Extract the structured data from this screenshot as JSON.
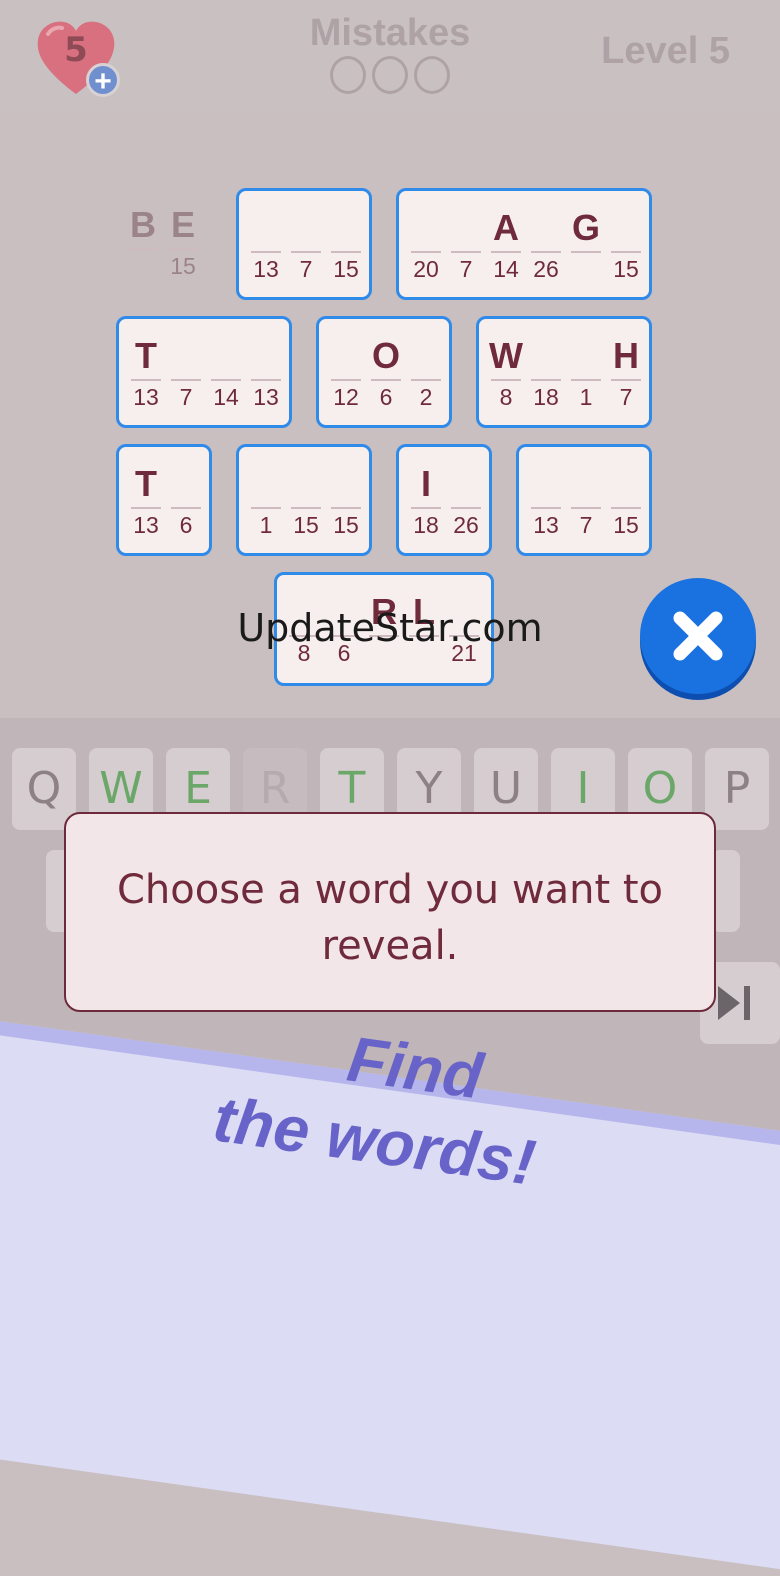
{
  "header": {
    "lives": "5",
    "mistakes_label": "Mistakes",
    "level_label": "Level 5"
  },
  "words": [
    {
      "id": "w1",
      "cells": [
        {
          "l": "B",
          "n": ""
        },
        {
          "l": "E",
          "n": "15"
        }
      ]
    },
    {
      "id": "w2",
      "cells": [
        {
          "l": "",
          "n": "13"
        },
        {
          "l": "",
          "n": "7"
        },
        {
          "l": "",
          "n": "15"
        }
      ]
    },
    {
      "id": "w3",
      "cells": [
        {
          "l": "",
          "n": "20"
        },
        {
          "l": "",
          "n": "7"
        },
        {
          "l": "A",
          "n": "14"
        },
        {
          "l": "",
          "n": "26"
        },
        {
          "l": "G",
          "n": ""
        },
        {
          "l": "",
          "n": "15"
        }
      ]
    },
    {
      "id": "w4",
      "cells": [
        {
          "l": "T",
          "n": "13"
        },
        {
          "l": "",
          "n": "7"
        },
        {
          "l": "",
          "n": "14"
        },
        {
          "l": "",
          "n": "13"
        }
      ]
    },
    {
      "id": "w5",
      "cells": [
        {
          "l": "",
          "n": "12"
        },
        {
          "l": "O",
          "n": "6"
        },
        {
          "l": "",
          "n": "2"
        }
      ]
    },
    {
      "id": "w6",
      "cells": [
        {
          "l": "W",
          "n": "8"
        },
        {
          "l": "",
          "n": "18"
        },
        {
          "l": "",
          "n": "1"
        },
        {
          "l": "H",
          "n": "7"
        }
      ]
    },
    {
      "id": "w7",
      "cells": [
        {
          "l": "T",
          "n": "13"
        },
        {
          "l": "",
          "n": "6"
        }
      ]
    },
    {
      "id": "w8",
      "cells": [
        {
          "l": "",
          "n": "1"
        },
        {
          "l": "",
          "n": "15"
        },
        {
          "l": "",
          "n": "15"
        }
      ]
    },
    {
      "id": "w9",
      "cells": [
        {
          "l": "I",
          "n": "18"
        },
        {
          "l": "",
          "n": "26"
        }
      ]
    },
    {
      "id": "w10",
      "cells": [
        {
          "l": "",
          "n": "13"
        },
        {
          "l": "",
          "n": "7"
        },
        {
          "l": "",
          "n": "15"
        }
      ]
    },
    {
      "id": "w11",
      "cells": [
        {
          "l": "",
          "n": "8"
        },
        {
          "l": "",
          "n": "6"
        },
        {
          "l": "R",
          "n": ""
        },
        {
          "l": "L",
          "n": ""
        },
        {
          "l": "",
          "n": "21"
        }
      ]
    }
  ],
  "keyboard_row1": [
    {
      "k": "Q",
      "state": "normal"
    },
    {
      "k": "W",
      "state": "green"
    },
    {
      "k": "E",
      "state": "green"
    },
    {
      "k": "R",
      "state": "used"
    },
    {
      "k": "T",
      "state": "green"
    },
    {
      "k": "Y",
      "state": "normal"
    },
    {
      "k": "U",
      "state": "normal"
    },
    {
      "k": "I",
      "state": "green"
    },
    {
      "k": "O",
      "state": "green"
    },
    {
      "k": "P",
      "state": "normal"
    }
  ],
  "watermark": "UpdateStar.com",
  "tooltip": "Choose a word you want to reveal.",
  "banner": {
    "line1": "Find",
    "line2": "the words!"
  },
  "colors": {
    "accent": "#1a72e0",
    "tile_border": "#2f8ae8",
    "letter": "#6f2a3b",
    "banner_text": "#6763c8"
  }
}
